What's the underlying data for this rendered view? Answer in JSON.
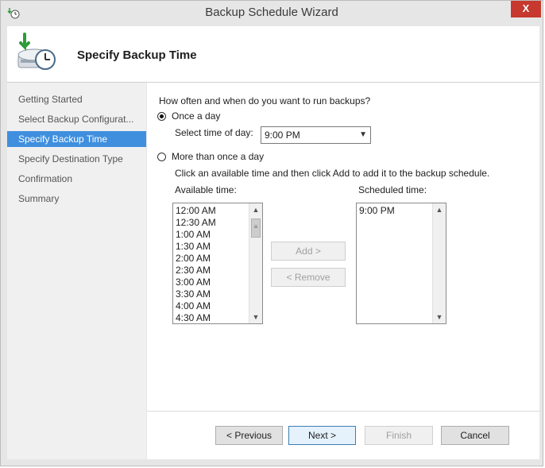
{
  "window": {
    "title": "Backup Schedule Wizard",
    "close_label": "X"
  },
  "header": {
    "title": "Specify Backup Time"
  },
  "nav": {
    "items": [
      {
        "label": "Getting Started"
      },
      {
        "label": "Select Backup Configurat..."
      },
      {
        "label": "Specify Backup Time",
        "active": true
      },
      {
        "label": "Specify Destination Type"
      },
      {
        "label": "Confirmation"
      },
      {
        "label": "Summary"
      }
    ]
  },
  "main": {
    "question": "How often and when do you want to run backups?",
    "once_label": "Once a day",
    "select_time_label": "Select time of day:",
    "selected_time": "9:00 PM",
    "more_label": "More than once a day",
    "instruction": "Click an available time and then click Add to add it to the backup schedule.",
    "available_label": "Available time:",
    "scheduled_label": "Scheduled time:",
    "available_times": [
      "12:00 AM",
      "12:30 AM",
      "1:00 AM",
      "1:30 AM",
      "2:00 AM",
      "2:30 AM",
      "3:00 AM",
      "3:30 AM",
      "4:00 AM",
      "4:30 AM"
    ],
    "scheduled_times": [
      "9:00 PM"
    ],
    "add_label": "Add >",
    "remove_label": "< Remove"
  },
  "footer": {
    "previous_label": "< Previous",
    "next_label": "Next >",
    "finish_label": "Finish",
    "cancel_label": "Cancel"
  }
}
